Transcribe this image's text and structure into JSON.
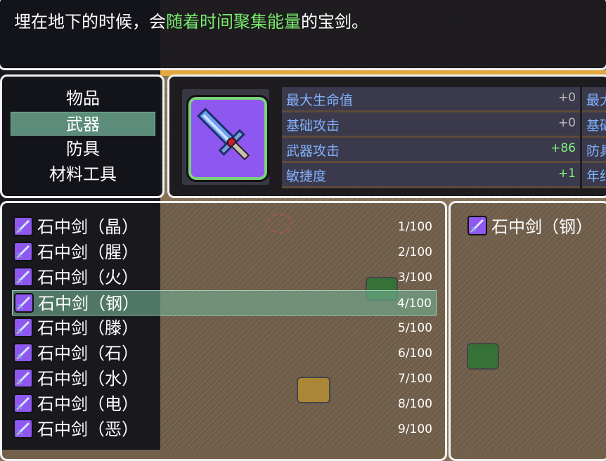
{
  "help": {
    "before": "埋在地下的时候，会",
    "highlight": "随着时间聚集能量",
    "after": "的宝剑。"
  },
  "categories": [
    {
      "label": "物品",
      "selected": false
    },
    {
      "label": "武器",
      "selected": true
    },
    {
      "label": "防具",
      "selected": false
    },
    {
      "label": "材料工具",
      "selected": false
    }
  ],
  "stats": [
    {
      "label": "最大生命值",
      "value": "+0",
      "positive": false
    },
    {
      "label": "基础攻击",
      "value": "+0",
      "positive": false
    },
    {
      "label": "武器攻击",
      "value": "+86",
      "positive": true
    },
    {
      "label": "敏捷度",
      "value": "+1",
      "positive": true
    }
  ],
  "stats_col2": [
    {
      "label": "最大"
    },
    {
      "label": "基础"
    },
    {
      "label": "防具"
    },
    {
      "label": "年纪"
    }
  ],
  "items": [
    {
      "name": "石中剑（晶）",
      "count": "1/100",
      "selected": false
    },
    {
      "name": "石中剑（腥）",
      "count": "2/100",
      "selected": false
    },
    {
      "name": "石中剑（火）",
      "count": "3/100",
      "selected": false
    },
    {
      "name": "石中剑（钢）",
      "count": "4/100",
      "selected": true
    },
    {
      "name": "石中剑（滕）",
      "count": "5/100",
      "selected": false
    },
    {
      "name": "石中剑（石）",
      "count": "6/100",
      "selected": false
    },
    {
      "name": "石中剑（水）",
      "count": "7/100",
      "selected": false
    },
    {
      "name": "石中剑（电）",
      "count": "8/100",
      "selected": false
    },
    {
      "name": "石中剑（恶）",
      "count": "9/100",
      "selected": false
    }
  ],
  "detail": {
    "name": "石中剑（钢）"
  },
  "icons": {
    "item": "sword-icon"
  },
  "colors": {
    "highlight": "#78ea6b",
    "stat_label": "#84b1ff",
    "positive": "#86f07e",
    "selection": "#5b8d7a"
  }
}
